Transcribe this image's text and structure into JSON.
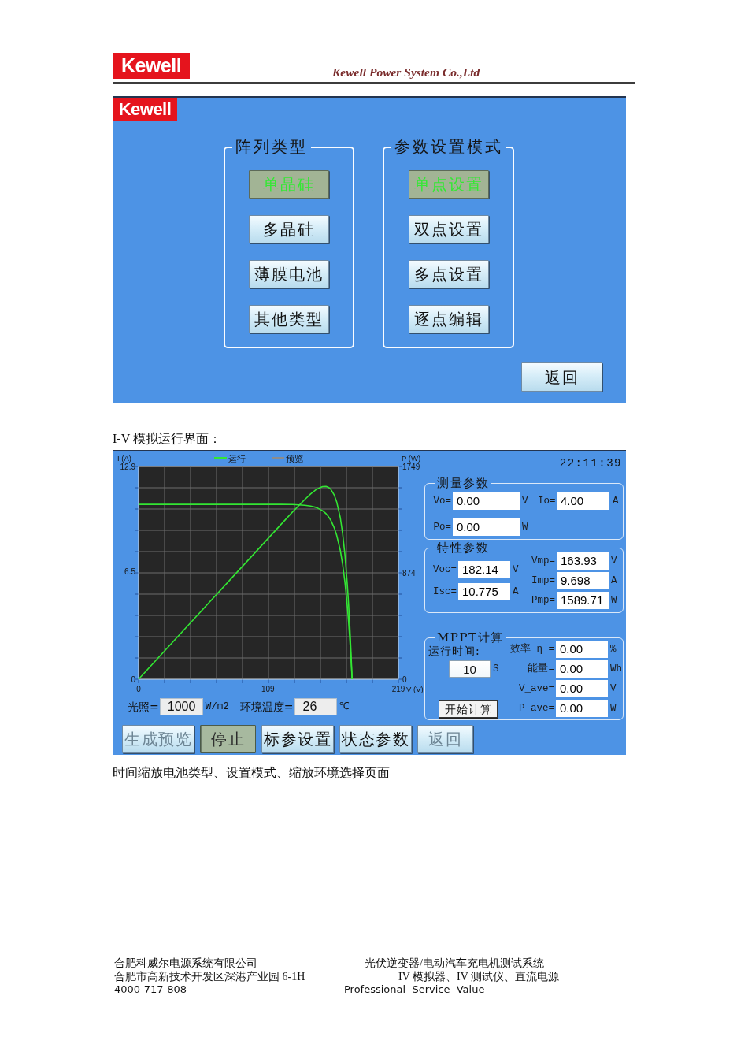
{
  "header": {
    "logo": "Kewell",
    "company": "Kewell Power System Co.,Ltd"
  },
  "panel1": {
    "logo": "Kewell",
    "groups": [
      {
        "title": "阵列类型",
        "buttons": [
          {
            "label": "单晶硅",
            "selected": true
          },
          {
            "label": "多晶硅",
            "selected": false
          },
          {
            "label": "薄膜电池",
            "selected": false
          },
          {
            "label": "其他类型",
            "selected": false
          }
        ]
      },
      {
        "title": "参数设置模式",
        "buttons": [
          {
            "label": "单点设置",
            "selected": true
          },
          {
            "label": "双点设置",
            "selected": false
          },
          {
            "label": "多点设置",
            "selected": false
          },
          {
            "label": "逐点编辑",
            "selected": false
          }
        ]
      }
    ],
    "back_button": "返回"
  },
  "caption_1": "I-V 模拟运行界面：",
  "panel2": {
    "chart_data": {
      "type": "line",
      "ylabel": "I (A)",
      "y2label": "P (W)",
      "xlabel": "V (V)",
      "x": [
        0,
        20,
        40,
        60,
        80,
        100,
        120,
        130,
        140,
        145,
        150,
        155,
        158,
        160,
        162,
        165,
        167,
        170,
        172,
        174,
        176,
        177,
        178,
        179,
        180
      ],
      "xlim": [
        0,
        219
      ],
      "ylim": [
        0,
        12.9
      ],
      "y2lim": [
        0,
        1749
      ],
      "xticks": [
        0,
        109,
        219
      ],
      "yticks": [
        0,
        6.5,
        12.9
      ],
      "y2ticks": [
        0,
        874,
        1749
      ],
      "series": [
        {
          "name": "运行",
          "color": "#33e633",
          "values": [
            10.6,
            10.6,
            10.6,
            10.6,
            10.6,
            10.6,
            10.6,
            10.59,
            10.55,
            10.5,
            10.41,
            10.22,
            10.04,
            9.86,
            9.64,
            9.17,
            8.73,
            7.81,
            6.95,
            5.84,
            4.38,
            3.5,
            2.48,
            1.32,
            0
          ]
        },
        {
          "color": "#33e633",
          "axis": "y2",
          "values": [
            0,
            212,
            424,
            636,
            848,
            1060,
            1272,
            1377,
            1477,
            1523,
            1562,
            1584,
            1586,
            1578,
            1562,
            1513,
            1458,
            1328,
            1195,
            1016,
            771,
            620,
            441,
            236,
            0
          ]
        },
        {
          "name": "预览",
          "color": "#8c8c8c",
          "values": [
            null,
            null,
            null,
            null,
            null,
            null,
            null,
            null,
            null,
            null,
            null,
            null,
            null,
            null,
            null,
            null,
            null,
            null,
            null,
            null,
            null,
            null,
            null,
            null,
            null
          ]
        }
      ]
    },
    "irradiance": {
      "label": "光照=",
      "value": "1000",
      "unit": "W/m2"
    },
    "temperature": {
      "label": "环境温度=",
      "value": "26",
      "unit": "℃"
    },
    "time": "22:11:39",
    "measured": {
      "title": "测量参数",
      "fields": [
        {
          "label": "Vo=",
          "value": "0.00",
          "unit": "V"
        },
        {
          "label": "Io=",
          "value": "4.00",
          "unit": "A"
        },
        {
          "label": "Po=",
          "value": "0.00",
          "unit": "W"
        }
      ]
    },
    "characteristic": {
      "title": "特性参数",
      "left_fields": [
        {
          "label": "Voc=",
          "value": "182.14",
          "unit": "V"
        },
        {
          "label": "Isc=",
          "value": "10.775",
          "unit": "A"
        }
      ],
      "right_fields": [
        {
          "label": "Vmp=",
          "value": "163.93",
          "unit": "V"
        },
        {
          "label": "Imp=",
          "value": "9.698",
          "unit": "A"
        },
        {
          "label": "Pmp=",
          "value": "1589.71",
          "unit": "W"
        }
      ]
    },
    "mppt": {
      "title": "MPPT计算",
      "run_time": {
        "label": "运行时间:",
        "value": "10",
        "unit": "S"
      },
      "start_button": "开始计算",
      "fields": [
        {
          "label": "效率 η =",
          "value": "0.00",
          "unit": "%"
        },
        {
          "label": "能量=",
          "value": "0.00",
          "unit": "Wh"
        },
        {
          "label": "V_ave=",
          "value": "0.00",
          "unit": "V"
        },
        {
          "label": "P_ave=",
          "value": "0.00",
          "unit": "W"
        }
      ]
    },
    "buttons": [
      {
        "label": "生成预览",
        "disabled": true,
        "pressed": false
      },
      {
        "label": "停止",
        "disabled": false,
        "pressed": true
      },
      {
        "label": "标参设置",
        "disabled": false,
        "pressed": false
      },
      {
        "label": "状态参数",
        "disabled": false,
        "pressed": false
      },
      {
        "label": "返回",
        "disabled": true,
        "pressed": false
      }
    ]
  },
  "caption_2": "时间缩放电池类型、设置模式、缩放环境选择页面",
  "footer": {
    "left": [
      "合肥科威尔电源系统有限公司",
      "合肥市高新技术开发区深港产业园 6-1H",
      "4000-717-808"
    ],
    "right": [
      "光伏逆变器/电动汽车充电机测试系统",
      "IV 模拟器、IV 测试仪、直流电源",
      "Professional  Service  Value"
    ]
  }
}
